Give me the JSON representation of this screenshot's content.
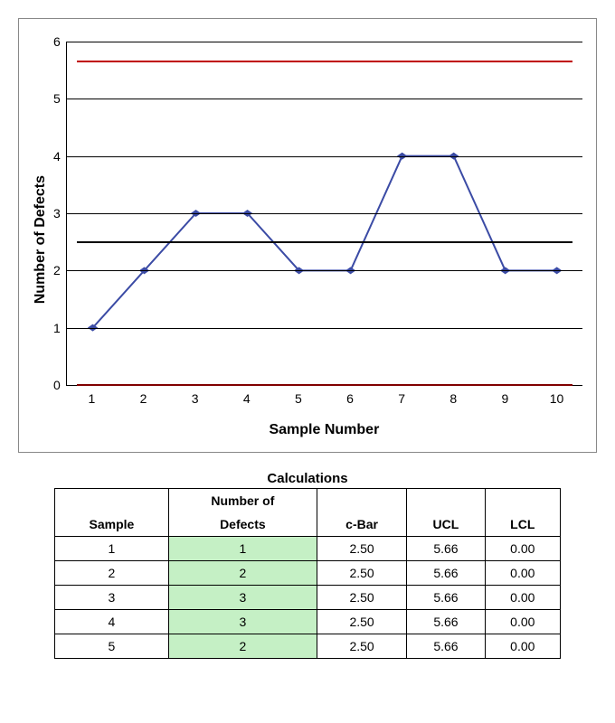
{
  "chart_data": {
    "type": "line",
    "xlabel": "Sample Number",
    "ylabel": "Number of Defects",
    "x": [
      1,
      2,
      3,
      4,
      5,
      6,
      7,
      8,
      9,
      10
    ],
    "values": [
      1,
      2,
      3,
      3,
      2,
      2,
      4,
      4,
      2,
      2
    ],
    "ucl": 5.66,
    "lcl": 0.0,
    "cbar": 2.5,
    "ylim": [
      0,
      6
    ],
    "yticks": [
      0,
      1,
      2,
      3,
      4,
      5,
      6
    ]
  },
  "table": {
    "title": "Calculations",
    "header_top": {
      "col2": "Number of"
    },
    "header": [
      "Sample",
      "Defects",
      "c-Bar",
      "UCL",
      "LCL"
    ],
    "rows": [
      {
        "sample": "1",
        "defects": "1",
        "cbar": "2.50",
        "ucl": "5.66",
        "lcl": "0.00"
      },
      {
        "sample": "2",
        "defects": "2",
        "cbar": "2.50",
        "ucl": "5.66",
        "lcl": "0.00"
      },
      {
        "sample": "3",
        "defects": "3",
        "cbar": "2.50",
        "ucl": "5.66",
        "lcl": "0.00"
      },
      {
        "sample": "4",
        "defects": "3",
        "cbar": "2.50",
        "ucl": "5.66",
        "lcl": "0.00"
      },
      {
        "sample": "5",
        "defects": "2",
        "cbar": "2.50",
        "ucl": "5.66",
        "lcl": "0.00"
      }
    ]
  }
}
